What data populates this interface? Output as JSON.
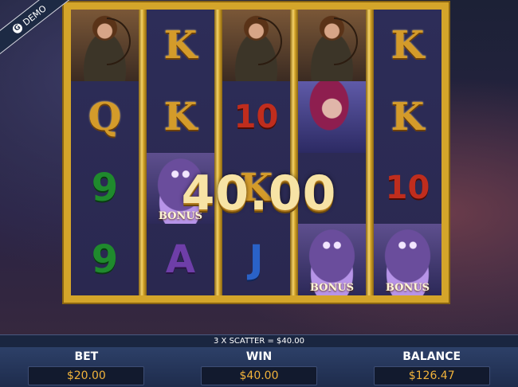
{
  "demo": {
    "label": "DEMO",
    "icon": "g-logo-icon",
    "icon_glyph": "G"
  },
  "reels": [
    [
      "archer",
      "Q",
      "9",
      "9"
    ],
    [
      "K",
      "K",
      "bonus",
      "A"
    ],
    [
      "archer",
      "10",
      "K",
      "J"
    ],
    [
      "archer",
      "witch",
      "",
      "bonus"
    ],
    [
      "K",
      "K",
      "10",
      "bonus"
    ]
  ],
  "bonus_label": "BONUS",
  "win_amount": "40.00",
  "scatter_message": "3 X SCATTER = $40.00",
  "footer": {
    "bet_label": "BET",
    "bet_value": "$20.00",
    "win_label": "WIN",
    "win_value": "$40.00",
    "balance_label": "BALANCE",
    "balance_value": "$126.47"
  },
  "colors": {
    "frame_gold": "#d4a52a",
    "value_orange": "#f1b33b",
    "footer_blue": "#2d4068"
  }
}
